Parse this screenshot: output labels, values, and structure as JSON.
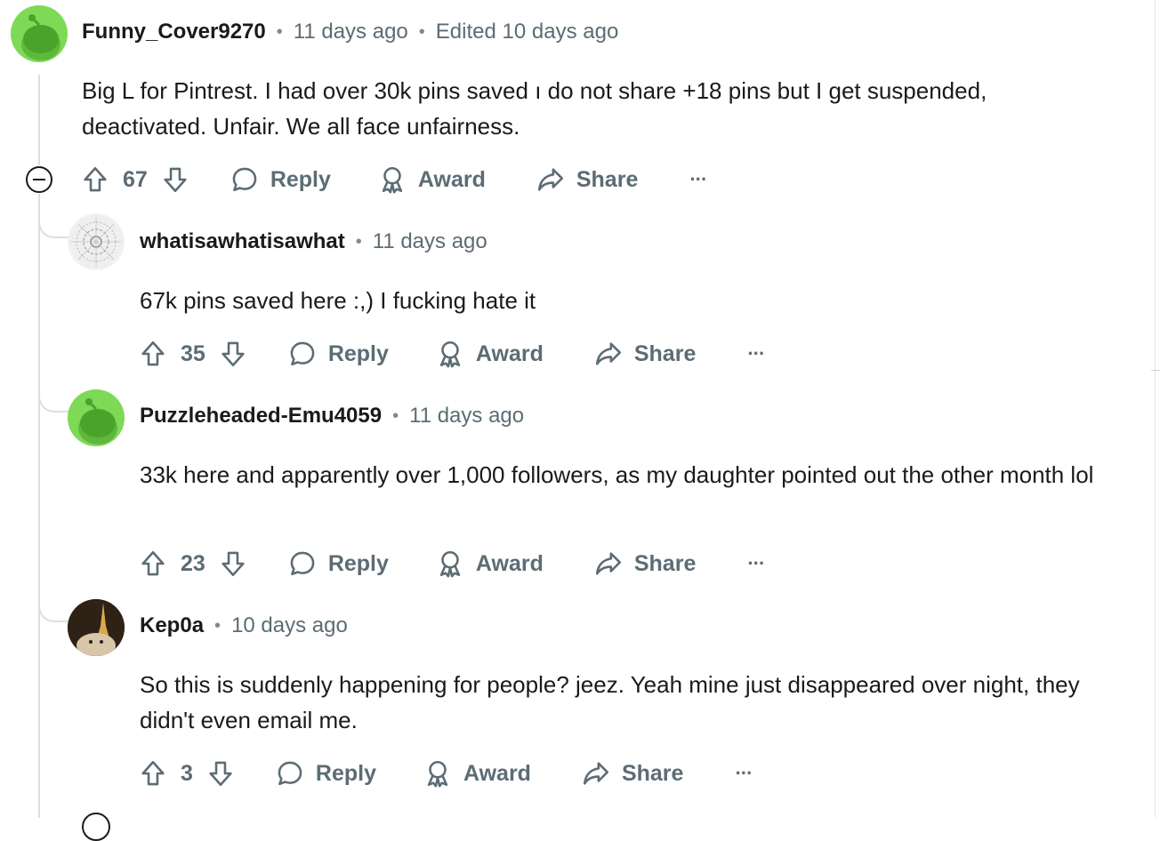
{
  "comments": [
    {
      "author": "Funny_Cover9270",
      "time": "11 days ago",
      "edited": "Edited 10 days ago",
      "text": "Big L for Pintrest. I had over 30k pins saved ı do not share +18 pins but I get suspended, deactivated. Unfair. We all face unfairness.",
      "score": "67",
      "avatar": "snoo-avatar-green"
    },
    {
      "author": "whatisawhatisawhat",
      "time": "11 days ago",
      "text": "67k pins saved here :,) I fucking hate it",
      "score": "35",
      "avatar": "lace-pattern-avatar"
    },
    {
      "author": "Puzzleheaded-Emu4059",
      "time": "11 days ago",
      "text": "33k here and apparently over 1,000 followers, as my daughter pointed out the other month lol",
      "score": "23",
      "avatar": "snoo-avatar-green"
    },
    {
      "author": "Kep0a",
      "time": "10 days ago",
      "text": "So this is suddenly happening for people? jeez. Yeah mine just disappeared over night, they didn't even email me.",
      "score": "3",
      "avatar": "photo-avatar-eiffel-tower"
    }
  ],
  "actions": {
    "reply": "Reply",
    "award": "Award",
    "share": "Share",
    "more": "···"
  },
  "colors": {
    "snoo_green": "#7ed957",
    "text_primary": "#1a1a1b",
    "text_meta": "#5c6c74",
    "thread_line": "#dcdfe1"
  },
  "icons": [
    "upvote-icon",
    "downvote-icon",
    "comment-bubble-icon",
    "award-icon",
    "share-arrow-icon",
    "more-dots-icon",
    "collapse-minus-icon"
  ]
}
